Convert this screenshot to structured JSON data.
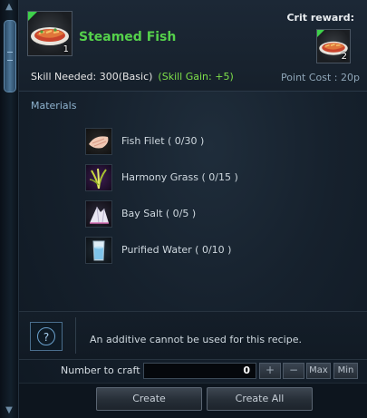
{
  "header": {
    "item_name": "Steamed Fish",
    "item_count": "1",
    "crit_reward_label": "Crit reward:",
    "crit_count": "2",
    "skill_needed": "Skill Needed: 300(Basic)",
    "skill_gain": "(Skill Gain:  +5)",
    "point_cost": "Point Cost  : 20p"
  },
  "materials": {
    "heading": "Materials",
    "items": [
      {
        "label": "Fish Filet ( 0/30 )",
        "icon": "fish-filet-icon"
      },
      {
        "label": "Harmony Grass ( 0/15 )",
        "icon": "harmony-grass-icon"
      },
      {
        "label": "Bay Salt ( 0/5 )",
        "icon": "bay-salt-icon"
      },
      {
        "label": "Purified Water ( 0/10 )",
        "icon": "purified-water-icon"
      }
    ]
  },
  "additive": {
    "help_glyph": "?",
    "message": "An additive cannot be used for this recipe."
  },
  "craft": {
    "label": "Number to craft",
    "quantity": "0",
    "plus": "+",
    "minus": "−",
    "max": "Max",
    "min": "Min"
  },
  "buttons": {
    "create": "Create",
    "create_all": "Create All"
  },
  "colors": {
    "item_name": "#55d14b",
    "skill_gain": "#7ee04a",
    "quality_corner": "#3fd14b"
  }
}
